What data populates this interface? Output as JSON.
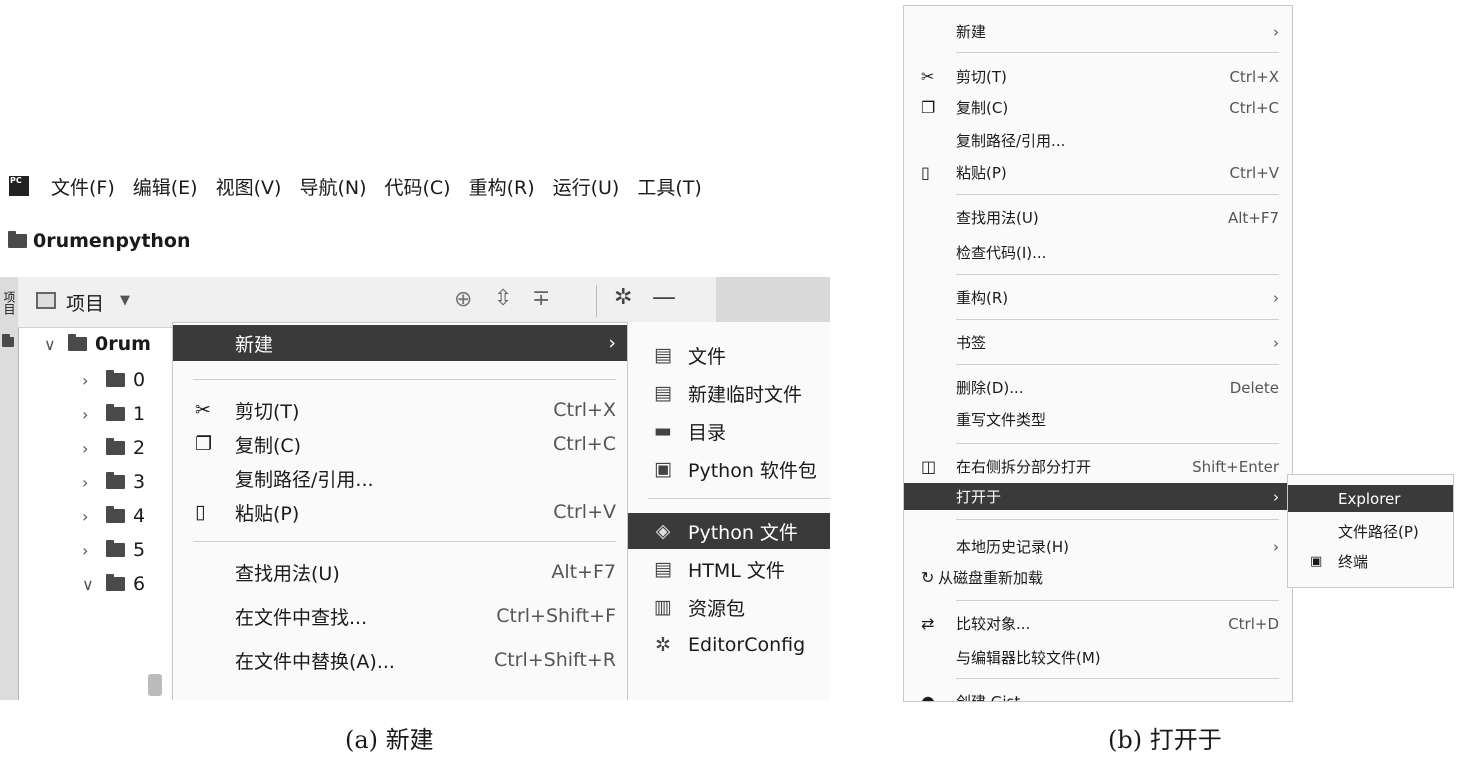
{
  "panel_a": {
    "menubar": {
      "logo": "PC",
      "items": [
        "文件(F)",
        "编辑(E)",
        "视图(V)",
        "导航(N)",
        "代码(C)",
        "重构(R)",
        "运行(U)",
        "工具(T)"
      ]
    },
    "breadcrumb": "0rumenpython",
    "side_tab": "项目",
    "toolbar": {
      "view_label": "项目",
      "dropdown_icon": "▼"
    },
    "tree": {
      "root": "0rum",
      "folders": [
        "0",
        "1",
        "2",
        "3",
        "4",
        "5",
        "6"
      ]
    },
    "context_menu": {
      "new": "新建",
      "cut": {
        "label": "剪切(T)",
        "shortcut": "Ctrl+X"
      },
      "copy": {
        "label": "复制(C)",
        "shortcut": "Ctrl+C"
      },
      "copy_path": "复制路径/引用...",
      "paste": {
        "label": "粘贴(P)",
        "shortcut": "Ctrl+V"
      },
      "find_usages": {
        "label": "查找用法(U)",
        "shortcut": "Alt+F7"
      },
      "find_in_files": {
        "label": "在文件中查找...",
        "shortcut": "Ctrl+Shift+F"
      },
      "replace_in_files": {
        "label": "在文件中替换(A)...",
        "shortcut": "Ctrl+Shift+R"
      }
    },
    "submenu_new": {
      "items": [
        "文件",
        "新建临时文件",
        "目录",
        "Python 软件包",
        "Python 文件",
        "HTML 文件",
        "资源包",
        "EditorConfig"
      ]
    },
    "caption": "(a) 新建"
  },
  "panel_b": {
    "context_menu": {
      "new": "新建",
      "cut": {
        "label": "剪切(T)",
        "shortcut": "Ctrl+X"
      },
      "copy": {
        "label": "复制(C)",
        "shortcut": "Ctrl+C"
      },
      "copy_path": "复制路径/引用...",
      "paste": {
        "label": "粘贴(P)",
        "shortcut": "Ctrl+V"
      },
      "find_usages": {
        "label": "查找用法(U)",
        "shortcut": "Alt+F7"
      },
      "inspect_code": "检查代码(I)...",
      "refactor": "重构(R)",
      "bookmarks": "书签",
      "delete": {
        "label": "删除(D)...",
        "shortcut": "Delete"
      },
      "override_type": "重写文件类型",
      "open_split": {
        "label": "在右侧拆分部分打开",
        "shortcut": "Shift+Enter"
      },
      "open_in": "打开于",
      "local_history": "本地历史记录(H)",
      "reload": "从磁盘重新加载",
      "compare_with": {
        "label": "比较对象...",
        "shortcut": "Ctrl+D"
      },
      "compare_editor": "与编辑器比较文件(M)",
      "create_gist": "创建 Gist..."
    },
    "submenu_open_in": {
      "explorer": "Explorer",
      "file_path": "文件路径(P)",
      "terminal": "终端"
    },
    "caption": "(b) 打开于"
  },
  "colors": {
    "selection": "#3a3a3a",
    "menu_bg": "#fafafa",
    "toolbar_bg": "#f0f0f0"
  }
}
